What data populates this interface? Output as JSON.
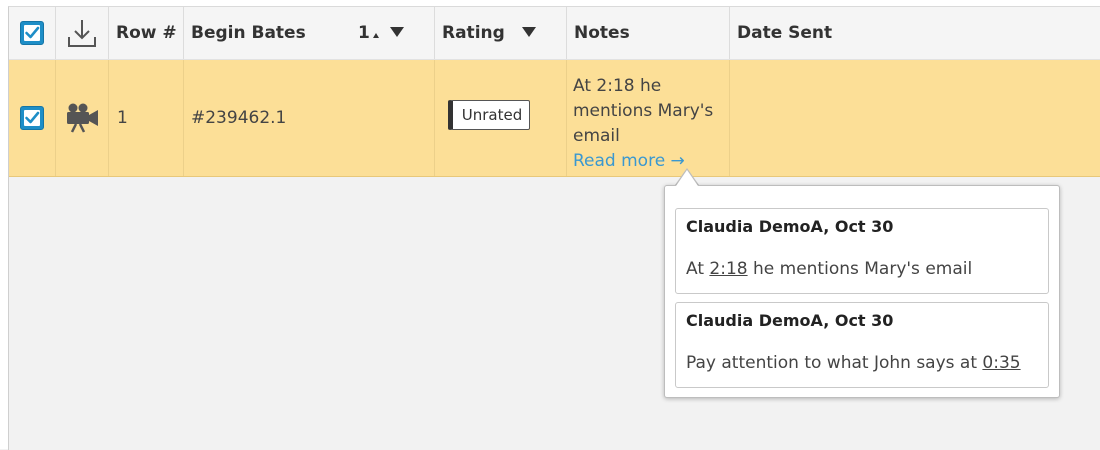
{
  "header": {
    "row_num_label": "Row #",
    "begin_bates_label": "Begin Bates",
    "sort_order": "1",
    "rating_label": "Rating",
    "notes_label": "Notes",
    "date_sent_label": "Date Sent"
  },
  "row": {
    "selected": true,
    "type_icon": "video-camera-icon",
    "row_num": "1",
    "begin_bates": "#239462.1",
    "rating": "Unrated",
    "notes_preview_line1": "At 2:18 he",
    "notes_preview_line2": "mentions Mary's",
    "notes_preview_line3": "email",
    "read_more": "Read more →",
    "date_sent": ""
  },
  "popover": {
    "notes": [
      {
        "author": "Claudia DemoA, Oct 30",
        "before": "At ",
        "timestamp": "2:18",
        "after": " he mentions Mary's email"
      },
      {
        "author": "Claudia DemoA, Oct 30",
        "before": "Pay attention to what John says at ",
        "timestamp": "0:35",
        "after": ""
      }
    ]
  },
  "colors": {
    "checkbox": "#1e8ec7",
    "selected_row": "#fcdf97",
    "link": "#3a98d0"
  }
}
